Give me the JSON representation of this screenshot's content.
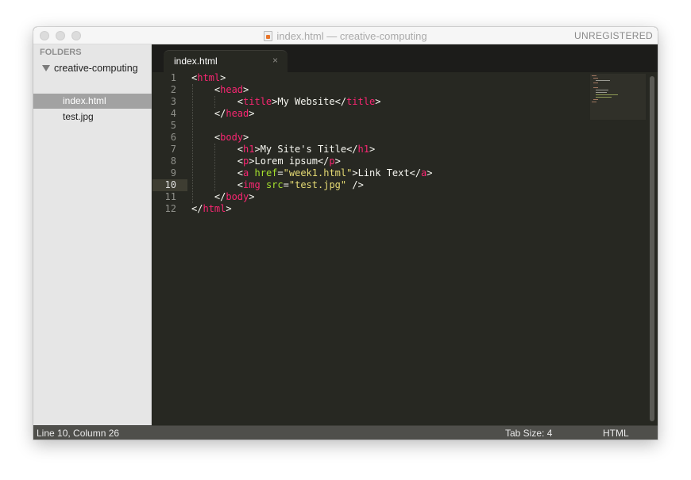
{
  "window": {
    "title": "index.html — creative-computing",
    "registration": "UNREGISTERED"
  },
  "sidebar": {
    "header": "FOLDERS",
    "folder": "creative-computing",
    "files": [
      {
        "name": "index.html",
        "selected": true
      },
      {
        "name": "test.jpg",
        "selected": false
      }
    ]
  },
  "tabs": [
    {
      "label": "index.html",
      "close": "×"
    }
  ],
  "editor": {
    "active_line": 10,
    "line_numbers": [
      "1",
      "2",
      "3",
      "4",
      "5",
      "6",
      "7",
      "8",
      "9",
      "10",
      "11",
      "12"
    ]
  },
  "statusbar": {
    "position": "Line 10, Column 26",
    "tab_size": "Tab Size: 4",
    "syntax": "HTML"
  },
  "colors": {
    "editor_bg": "#272822",
    "tag": "#f92672",
    "attribute": "#a6e22e",
    "string": "#e6db74",
    "text": "#f8f8f2"
  },
  "icons": {
    "file": "html-file-icon",
    "folder_toggle": "disclosure-triangle-icon",
    "tab_close": "close-icon"
  }
}
